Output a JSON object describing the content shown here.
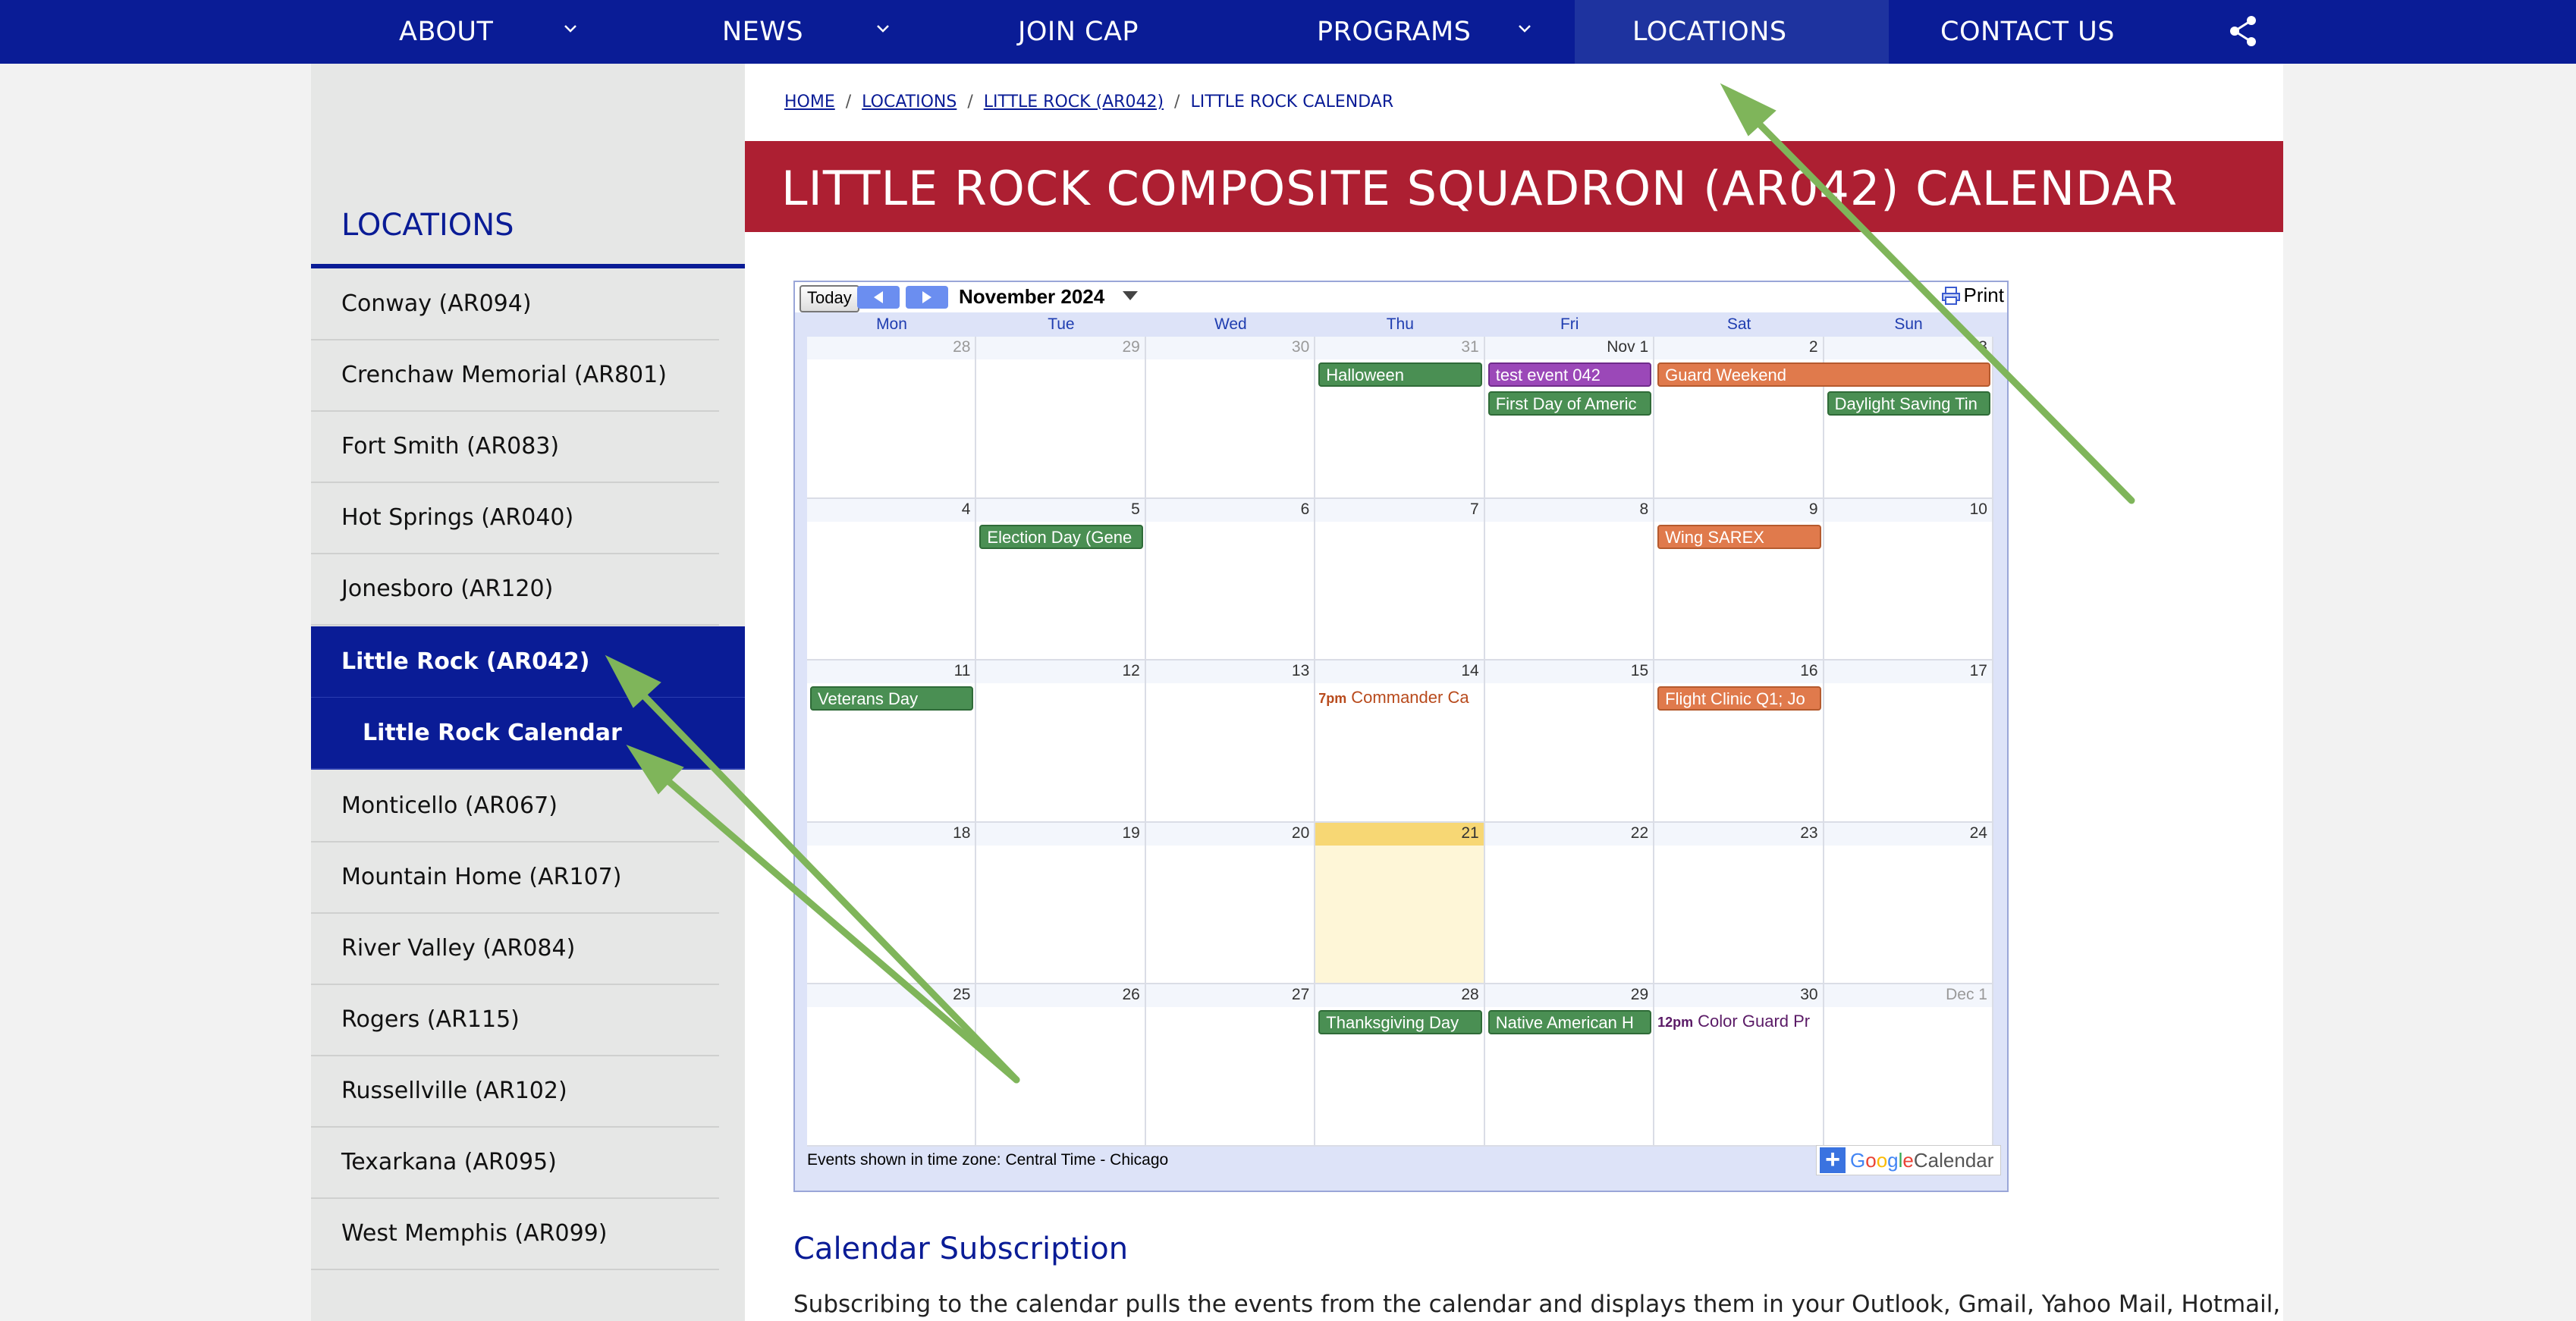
{
  "nav": {
    "items": [
      {
        "label": "ABOUT",
        "dropdown": true
      },
      {
        "label": "NEWS",
        "dropdown": true
      },
      {
        "label": "JOIN CAP",
        "dropdown": false
      },
      {
        "label": "PROGRAMS",
        "dropdown": true
      },
      {
        "label": "LOCATIONS",
        "dropdown": false,
        "active": true
      },
      {
        "label": "CONTACT US",
        "dropdown": false
      }
    ],
    "share_icon": "share-icon"
  },
  "sidebar": {
    "title": "LOCATIONS",
    "items": [
      {
        "label": "Conway (AR094)"
      },
      {
        "label": "Crenchaw Memorial (AR801)"
      },
      {
        "label": "Fort Smith (AR083)"
      },
      {
        "label": "Hot Springs (AR040)"
      },
      {
        "label": "Jonesboro (AR120)"
      },
      {
        "label": "Little Rock (AR042)",
        "active": true
      },
      {
        "label": "Little Rock Calendar",
        "active": true,
        "sub": true
      },
      {
        "label": "Monticello (AR067)"
      },
      {
        "label": "Mountain Home (AR107)"
      },
      {
        "label": "River Valley (AR084)"
      },
      {
        "label": "Rogers (AR115)"
      },
      {
        "label": "Russellville (AR102)"
      },
      {
        "label": "Texarkana (AR095)"
      },
      {
        "label": "West Memphis (AR099)"
      }
    ]
  },
  "breadcrumb": {
    "items": [
      "HOME",
      "LOCATIONS",
      "LITTLE ROCK (AR042)",
      "LITTLE ROCK CALENDAR"
    ],
    "separator": "/"
  },
  "page_title": "LITTLE ROCK COMPOSITE SQUADRON (AR042) CALENDAR",
  "calendar": {
    "today_label": "Today",
    "month": "November 2024",
    "print_label": "Print",
    "weekdays": [
      "Mon",
      "Tue",
      "Wed",
      "Thu",
      "Fri",
      "Sat",
      "Sun"
    ],
    "weeks": [
      [
        "28",
        "29",
        "30",
        "31",
        "Nov 1",
        "2",
        "3"
      ],
      [
        "4",
        "5",
        "6",
        "7",
        "8",
        "9",
        "10"
      ],
      [
        "11",
        "12",
        "13",
        "14",
        "15",
        "16",
        "17"
      ],
      [
        "18",
        "19",
        "20",
        "21",
        "22",
        "23",
        "24"
      ],
      [
        "25",
        "26",
        "27",
        "28",
        "29",
        "30",
        "Dec 1"
      ]
    ],
    "today": "21",
    "events": [
      {
        "week": 0,
        "day": 3,
        "span": 1,
        "row": 0,
        "title": "Halloween",
        "color": "green"
      },
      {
        "week": 0,
        "day": 4,
        "span": 1,
        "row": 0,
        "title": "test event 042",
        "color": "purple"
      },
      {
        "week": 0,
        "day": 5,
        "span": 2,
        "row": 0,
        "title": "Guard Weekend",
        "color": "orange"
      },
      {
        "week": 0,
        "day": 4,
        "span": 1,
        "row": 1,
        "title": "First Day of Americ",
        "color": "green"
      },
      {
        "week": 0,
        "day": 6,
        "span": 1,
        "row": 1,
        "title": "Daylight Saving Tin",
        "color": "green"
      },
      {
        "week": 1,
        "day": 1,
        "span": 1,
        "row": 0,
        "title": "Election Day (Gene",
        "color": "green"
      },
      {
        "week": 1,
        "day": 5,
        "span": 1,
        "row": 0,
        "title": "Wing SAREX",
        "color": "orange"
      },
      {
        "week": 2,
        "day": 0,
        "span": 1,
        "row": 0,
        "title": "Veterans Day",
        "color": "green"
      },
      {
        "week": 2,
        "day": 5,
        "span": 1,
        "row": 0,
        "title": "Flight Clinic Q1; Jo",
        "color": "orange"
      },
      {
        "week": 4,
        "day": 3,
        "span": 1,
        "row": 0,
        "title": "Thanksgiving Day",
        "color": "green"
      },
      {
        "week": 4,
        "day": 4,
        "span": 1,
        "row": 0,
        "title": "Native American H",
        "color": "green"
      }
    ],
    "timed_events": [
      {
        "week": 2,
        "day": 3,
        "time": "7pm",
        "title": "Commander Ca",
        "color": "#b84a1c"
      },
      {
        "week": 4,
        "day": 5,
        "time": "12pm",
        "title": "Color Guard Pr",
        "color": "#5a1a66"
      }
    ],
    "footer": "Events shown in time zone: Central Time - Chicago",
    "gcal_google": "Google",
    "gcal_calendar": "Calendar",
    "colors": {
      "green": "#4a8f53",
      "purple": "#9b48b8",
      "orange": "#e07a4c",
      "today": "#fef6d7"
    }
  },
  "subscription": {
    "heading": "Calendar Subscription",
    "text": "Subscribing to the calendar pulls the events from the calendar and displays them in your Outlook, Gmail, Yahoo Mail, Hotmail,"
  },
  "colors": {
    "nav_bg": "#0a1c96",
    "banner_bg": "#ad1f32",
    "annotation": "#7fb55a"
  }
}
